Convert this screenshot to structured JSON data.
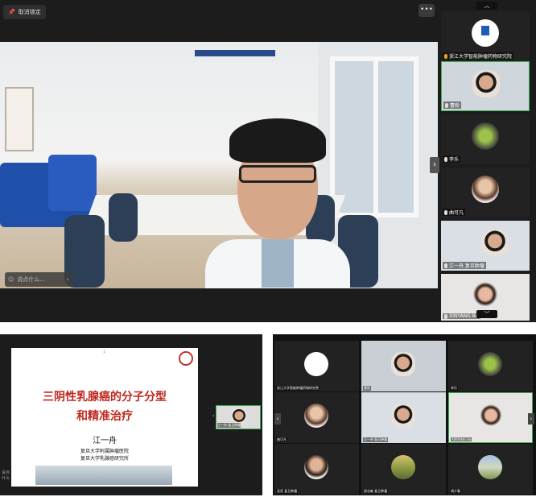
{
  "top_window": {
    "unlock_label": "取消锁定",
    "more_label": "•••",
    "chat_placeholder": "说点什么...",
    "chat_send": "‹",
    "side_arrow": "›"
  },
  "sidebar": {
    "scroll_up": "︿",
    "scroll_down": "﹀",
    "tiles": [
      {
        "label": "浙江大学智能肿瘤药物研究院"
      },
      {
        "label": "曹毅"
      },
      {
        "label": "李乐"
      },
      {
        "label": "曲可凡"
      },
      {
        "label": "江一舟 复旦肿瘤"
      },
      {
        "label": "XINYANG Bo"
      }
    ]
  },
  "slide": {
    "page_num": "1",
    "title_line1": "三阴性乳腺癌的分子分型",
    "title_line2": "和精准治疗",
    "author": "江一舟",
    "affiliation1": "复旦大学附属肿瘤医院",
    "affiliation2": "复旦大学乳腺癌研究所",
    "mini_label": "江一舟 复旦肿瘤",
    "chat_hint": "说点什么"
  },
  "gallery": {
    "left_arrow": "‹",
    "right_arrow": "›",
    "tiles": [
      {
        "label": "浙江大学智能肿瘤药物研究院"
      },
      {
        "label": "曹毅"
      },
      {
        "label": "李乐"
      },
      {
        "label": "曲可凡"
      },
      {
        "label": "江一舟 复旦肿瘤"
      },
      {
        "label": "XINYANG Bo"
      },
      {
        "label": "吴炅 复旦肿瘤"
      },
      {
        "label": "邵志敏 复旦肿瘤"
      },
      {
        "label": "胡夕春"
      }
    ]
  },
  "colors": {
    "slide_title": "#c0271e",
    "active_border": "#3cb050"
  }
}
